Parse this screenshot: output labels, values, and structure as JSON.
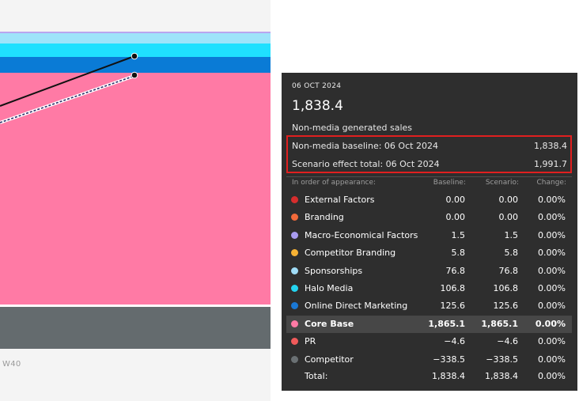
{
  "chart_data": {
    "type": "area",
    "x_tick_label": "W40",
    "colors": {
      "pink": "#ff7aa5",
      "gray": "#646b6e",
      "blue1": "#0a7bd6",
      "cyan": "#1fe0ff",
      "lightblue": "#9ee4fa",
      "lavender": "#b9a6ef"
    }
  },
  "tooltip": {
    "date": "06 OCT 2024",
    "value": "1,838.4",
    "subtitle": "Non-media generated sales",
    "baseline_row": {
      "label": "Non-media baseline: 06 Oct 2024",
      "value": "1,838.4"
    },
    "scenario_row": {
      "label": "Scenario effect total: 06 Oct 2024",
      "value": "1,991.7"
    },
    "headers": {
      "order": "In order of appearance:",
      "baseline": "Baseline:",
      "scenario": "Scenario:",
      "change": "Change:"
    },
    "rows": [
      {
        "name": "External Factors",
        "color": "#d62d2d",
        "baseline": "0.00",
        "scenario": "0.00",
        "change": "0.00%"
      },
      {
        "name": "Branding",
        "color": "#f26a3a",
        "baseline": "0.00",
        "scenario": "0.00",
        "change": "0.00%"
      },
      {
        "name": "Macro-Economical Factors",
        "color": "#a99cf0",
        "baseline": "1.5",
        "scenario": "1.5",
        "change": "0.00%"
      },
      {
        "name": "Competitor Branding",
        "color": "#f7b234",
        "baseline": "5.8",
        "scenario": "5.8",
        "change": "0.00%"
      },
      {
        "name": "Sponsorships",
        "color": "#9fdcf7",
        "baseline": "76.8",
        "scenario": "76.8",
        "change": "0.00%"
      },
      {
        "name": "Halo Media",
        "color": "#24d4f0",
        "baseline": "106.8",
        "scenario": "106.8",
        "change": "0.00%"
      },
      {
        "name": "Online Direct Marketing",
        "color": "#1a78d4",
        "baseline": "125.6",
        "scenario": "125.6",
        "change": "0.00%"
      },
      {
        "name": "Core Base",
        "color": "#ff7aa5",
        "baseline": "1,865.1",
        "scenario": "1,865.1",
        "change": "0.00%"
      },
      {
        "name": "PR",
        "color": "#f05a5a",
        "baseline": "−4.6",
        "scenario": "−4.6",
        "change": "0.00%"
      },
      {
        "name": "Competitor",
        "color": "#6a7073",
        "baseline": "−338.5",
        "scenario": "−338.5",
        "change": "0.00%"
      }
    ],
    "total": {
      "name": "Total:",
      "baseline": "1,838.4",
      "scenario": "1,838.4",
      "change": "0.00%"
    }
  }
}
